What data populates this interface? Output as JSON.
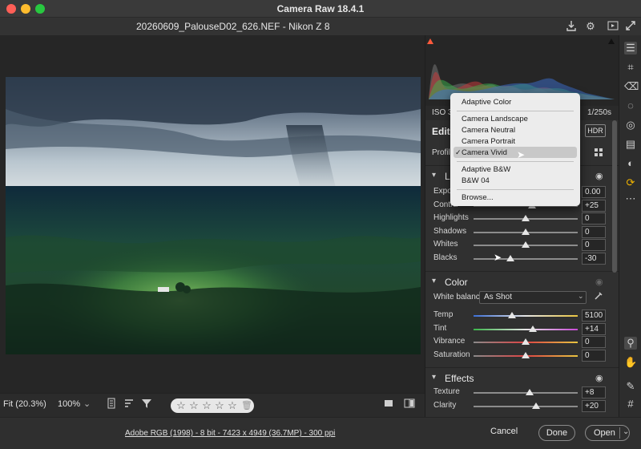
{
  "window": {
    "title": "Camera Raw 18.4.1"
  },
  "file": {
    "title": "20260609_PalouseD02_626.NEF  -  Nikon Z 8"
  },
  "top_icons": [
    "download-icon",
    "gear-icon",
    "fullscreen-preview-icon",
    "expand-icon"
  ],
  "image_toolbar": {
    "fit_label": "Fit (20.3%)",
    "zoom_value": "100%",
    "zoom_chevron": "⌄",
    "rating": "0 of 5 stars"
  },
  "status": {
    "workflow": "Adobe RGB (1998) - 8 bit - 7423 x 4949 (36.7MP) - 300 ppi",
    "cancel_label": "Cancel",
    "done_label": "Done",
    "open_label": "Open",
    "open_chevron": "⌄"
  },
  "info": {
    "iso": "ISO 32",
    "shutter": "1/250s"
  },
  "edit": {
    "title": "Edit",
    "hdr_label": "HDR",
    "profile_label": "Profile"
  },
  "profile_menu": {
    "items": [
      "Adaptive Color",
      "Camera Landscape",
      "Camera Neutral",
      "Camera Portrait",
      "Camera Vivid",
      "Adaptive B&W",
      "B&W 04",
      "Browse..."
    ],
    "selected": "Camera Vivid",
    "check": "✓"
  },
  "light": {
    "title_fragment": "Li",
    "sliders": [
      {
        "label": "Expos",
        "value": "0.00",
        "position": 0.5
      },
      {
        "label": "Contra",
        "value": "+25",
        "position": 0.56
      },
      {
        "label": "Highlights",
        "value": "0",
        "position": 0.5
      },
      {
        "label": "Shadows",
        "value": "0",
        "position": 0.5
      },
      {
        "label": "Whites",
        "value": "0",
        "position": 0.5
      },
      {
        "label": "Blacks",
        "value": "-30",
        "position": 0.35
      }
    ]
  },
  "color": {
    "title": "Color",
    "white_balance_label": "White balance",
    "white_balance_value": "As Shot",
    "sliders": [
      {
        "label": "Temp",
        "value": "5100",
        "position": 0.37
      },
      {
        "label": "Tint",
        "value": "+14",
        "position": 0.57
      },
      {
        "label": "Vibrance",
        "value": "0",
        "position": 0.5
      },
      {
        "label": "Saturation",
        "value": "0",
        "position": 0.5
      }
    ]
  },
  "effects": {
    "title": "Effects",
    "sliders": [
      {
        "label": "Texture",
        "value": "+8",
        "position": 0.54
      },
      {
        "label": "Clarity",
        "value": "+20",
        "position": 0.6
      }
    ]
  },
  "colors": {
    "accent": "#e8e8e8",
    "menu_bg": "#ececec",
    "warning": "#ff5a3c"
  }
}
